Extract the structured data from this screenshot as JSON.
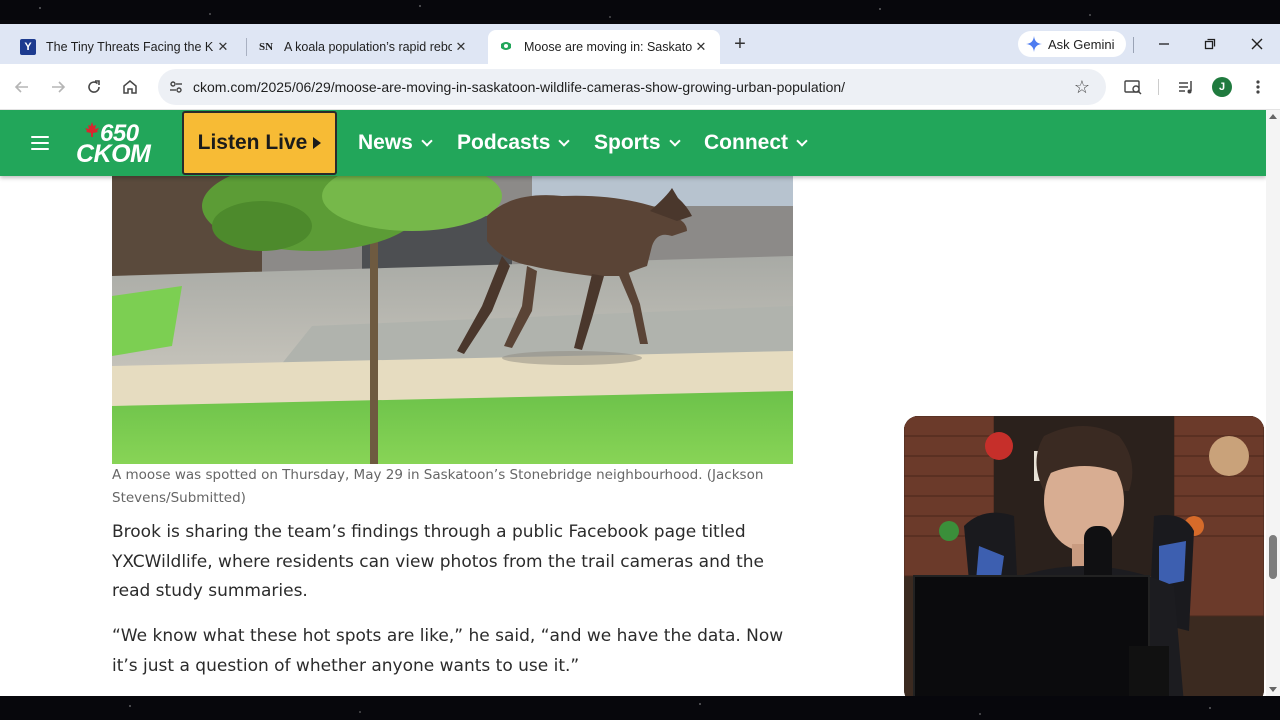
{
  "browser": {
    "tabs": [
      {
        "title": "The Tiny Threats Facing the Kin",
        "favicon": "Y",
        "active": false
      },
      {
        "title": "A koala population’s rapid rebo",
        "favicon": "SN",
        "active": false
      },
      {
        "title": "Moose are moving in: Saskatoo",
        "favicon": "ckom-icon",
        "active": true
      }
    ],
    "new_tab_label": "+",
    "gemini_label": "Ask Gemini",
    "url": "ckom.com/2025/06/29/moose-are-moving-in-saskatoon-wildlife-cameras-show-growing-urban-population/",
    "profile_initial": "J"
  },
  "site": {
    "brand_color": "#22a65a",
    "logo_number": "650",
    "logo_name": "CKOM",
    "listen_live": "Listen Live",
    "nav": [
      "News",
      "Podcasts",
      "Sports",
      "Connect"
    ]
  },
  "article": {
    "caption": "A moose was spotted on Thursday, May 29 in Saskatoon’s Stonebridge neighbourhood. (Jackson Stevens/Submitted)",
    "paragraphs": [
      "Brook is sharing the team’s findings through a public Facebook page titled YXCWildlife, where residents can view photos from the trail cameras and the read study summaries.",
      "“We know what these hot spots are like,” he said, “and we have the data. Now it’s just a question of whether anyone wants to use it.”"
    ]
  }
}
